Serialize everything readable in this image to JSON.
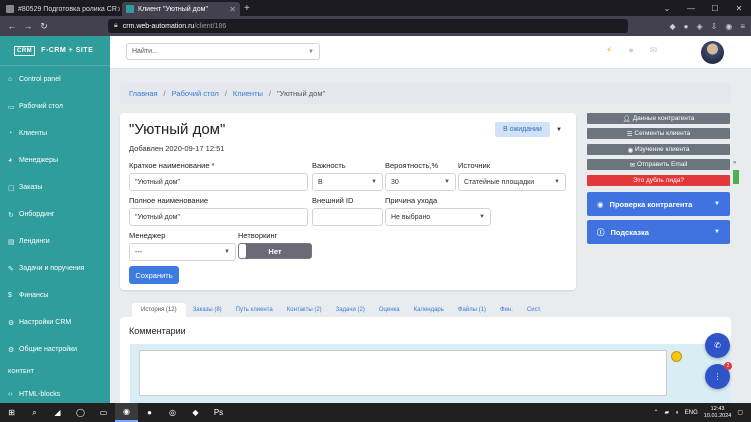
{
  "browser": {
    "tabs": [
      {
        "title": "#80529 Подготовка ролика CR"
      },
      {
        "title": "Клиент \"Уютный дом\""
      }
    ],
    "url_host": "crm.web-automation.ru",
    "url_path": "/client/186"
  },
  "sidebar": {
    "brand": "F-CRM + SITE",
    "logo": "CRM",
    "items": [
      {
        "label": "Control panel",
        "icon": "home-icon"
      },
      {
        "label": "Рабочий стол",
        "icon": "desktop-icon"
      },
      {
        "label": "Клиенты",
        "icon": "users-icon"
      },
      {
        "label": "Менеджеры",
        "icon": "user-tie-icon"
      },
      {
        "label": "Заказы",
        "icon": "cart-icon"
      },
      {
        "label": "Онбординг",
        "icon": "refresh-icon"
      },
      {
        "label": "Лендинги",
        "icon": "layout-icon"
      },
      {
        "label": "Задачи и поручения",
        "icon": "tasks-icon"
      },
      {
        "label": "Финансы",
        "icon": "dollar-icon"
      },
      {
        "label": "Настройки CRM",
        "icon": "gear-icon"
      },
      {
        "label": "Общие настройки",
        "icon": "gears-icon"
      }
    ],
    "section": "КОНТЕНТ",
    "cut_item": "HTML-blocks"
  },
  "header": {
    "search_placeholder": "Найти..."
  },
  "breadcrumb": {
    "items": [
      "Главная",
      "Рабочий стол",
      "Клиенты"
    ],
    "current": "\"Уютный дом\""
  },
  "client": {
    "title": "\"Уютный дом\"",
    "added": "Добавлен 2020-09-17 12:51",
    "status": "В ожидании",
    "fields": {
      "short_name_label": "Краткое наименование *",
      "short_name_value": "\"Уютный дом\"",
      "importance_label": "Важность",
      "importance_value": "B",
      "probability_label": "Вероятность,%",
      "probability_value": "30",
      "source_label": "Источник",
      "source_value": "Статейные площадки",
      "full_name_label": "Полное наименование",
      "full_name_value": "\"Уютный дом\"",
      "external_id_label": "Внешний ID",
      "external_id_value": "",
      "reason_label": "Причина ухода",
      "reason_value": "Не выбрано",
      "manager_label": "Менеджер",
      "manager_value": "---",
      "networking_label": "Нетворкинг",
      "networking_value": "Нет"
    },
    "save_label": "Сохранить"
  },
  "right_panel": {
    "buttons": [
      {
        "label": "Данные контрагента",
        "icon": "user-icon"
      },
      {
        "label": "Сегменты клиента",
        "icon": "list-icon"
      },
      {
        "label": "Изучение клиента",
        "icon": "eye-icon"
      },
      {
        "label": "Отправить Email",
        "icon": "mail-icon"
      },
      {
        "label": "Это дубль лида?",
        "icon": ""
      }
    ],
    "collapsibles": [
      {
        "label": "Проверка контрагента",
        "icon": "eye-icon"
      },
      {
        "label": "Подсказка",
        "icon": "info-icon"
      }
    ]
  },
  "tabs": [
    "История (12)",
    "Заказы (8)",
    "Путь клиента",
    "Контакты (2)",
    "Задачи (2)",
    "Оценка",
    "Календарь",
    "Файлы (1)",
    "Фин.",
    "Сист."
  ],
  "comments": {
    "title": "Комментарии"
  },
  "fab_badge": "2",
  "taskbar": {
    "lang": "ENG",
    "time": "12:43",
    "date": "10.01.2024"
  },
  "colors": {
    "sidebar": "#2e9d9b",
    "primary": "#3d7be0",
    "danger": "#e2383a",
    "secondary": "#6c757d"
  }
}
